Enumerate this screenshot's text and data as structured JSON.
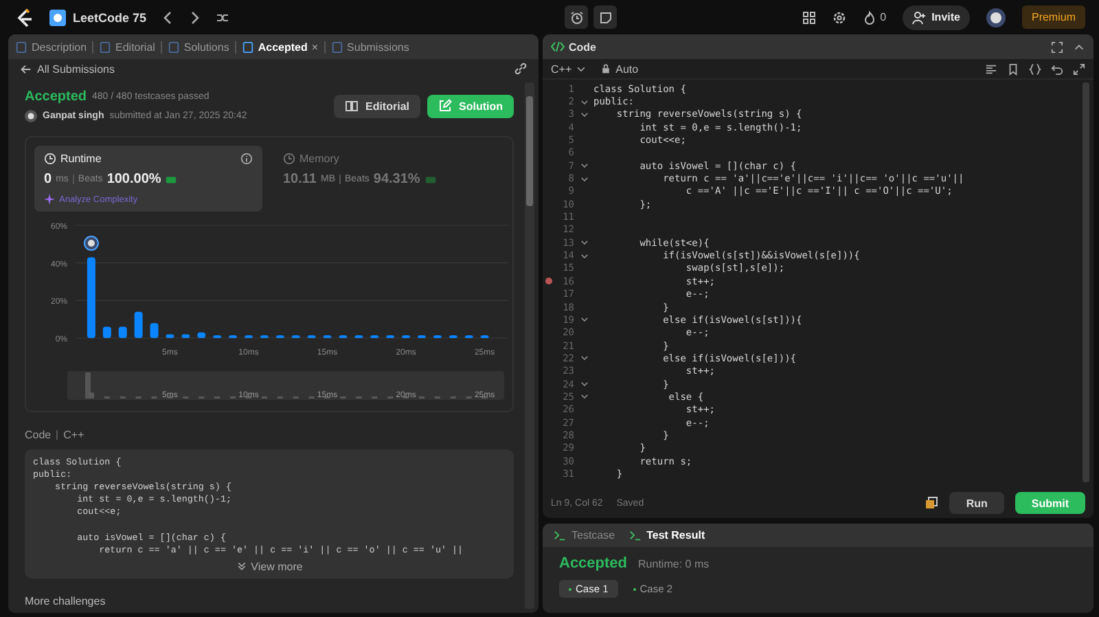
{
  "topbar": {
    "title": "LeetCode 75",
    "streak": "0",
    "invite": "Invite",
    "premium": "Premium"
  },
  "tabs": [
    {
      "label": "Description",
      "selected": false
    },
    {
      "label": "Editorial",
      "selected": false
    },
    {
      "label": "Solutions",
      "selected": false
    },
    {
      "label": "Accepted",
      "selected": true,
      "close": "×"
    },
    {
      "label": "Submissions",
      "selected": false
    }
  ],
  "back": "All Submissions",
  "result": {
    "status": "Accepted",
    "passed": "480 / 480 testcases passed",
    "user": "Ganpat singh",
    "submitted": "submitted at Jan 27, 2025 20:42",
    "editorial": "Editorial",
    "solution": "Solution"
  },
  "stats": [
    {
      "title": "Runtime",
      "value": "0",
      "unit": "ms",
      "beats_label": "Beats",
      "beats": "100.00%",
      "selected": true,
      "link": "Analyze Complexity"
    },
    {
      "title": "Memory",
      "value": "10.11",
      "unit": "MB",
      "beats_label": "Beats",
      "beats": "94.31%",
      "selected": false
    }
  ],
  "chart_data": {
    "type": "bar",
    "x": [
      0,
      1,
      2,
      3,
      4,
      5,
      6,
      7,
      8,
      9,
      10,
      11,
      12,
      13,
      14,
      15,
      16,
      17,
      18,
      19,
      20,
      21,
      22,
      23,
      24,
      25
    ],
    "series": [
      {
        "color": "#0a84ff",
        "values": [
          43,
          6,
          6,
          14,
          8,
          2,
          2,
          3,
          1.5,
          1.5,
          1.5,
          1.5,
          1.5,
          1.5,
          1.5,
          1.5,
          1.5,
          1.5,
          1.5,
          1.5,
          1.5,
          1.5,
          1.5,
          1.5,
          1.5,
          1.5
        ]
      }
    ],
    "xlim": [
      -1,
      26.5
    ],
    "ylim": [
      0,
      60
    ],
    "yticks": [
      {
        "value": 0,
        "label": "0%"
      },
      {
        "value": 20,
        "label": "20%"
      },
      {
        "value": 40,
        "label": "40%"
      },
      {
        "value": 60,
        "label": "60%"
      }
    ],
    "xticks": [
      {
        "value": 5,
        "label": "5ms"
      },
      {
        "value": 10,
        "label": "10ms"
      },
      {
        "value": 15,
        "label": "15ms"
      },
      {
        "value": 20,
        "label": "20ms"
      },
      {
        "value": 25,
        "label": "25ms"
      }
    ]
  },
  "code_header": {
    "label": "Code",
    "language": "C++"
  },
  "code_preview": "class Solution {\npublic:\n    string reverseVowels(string s) {\n        int st = 0,e = s.length()-1;\n        cout<<e;\n\n        auto isVowel = [](char c) {\n            return c == 'a' || c == 'e' || c == 'i' || c == 'o' || c == 'u' ||",
  "view_more": "View more",
  "more": "More challenges",
  "editor": {
    "title": "Code",
    "language": "C++",
    "mode": "Auto",
    "lines": [
      {
        "n": "1",
        "code": "class Solution {",
        "fold": false,
        "breakpoint": false
      },
      {
        "n": "2",
        "code": "public:",
        "fold": true,
        "breakpoint": false
      },
      {
        "n": "3",
        "code": "    string reverseVowels(string s) {",
        "fold": true,
        "breakpoint": false
      },
      {
        "n": "4",
        "code": "        int st = 0,e = s.length()-1;",
        "fold": false,
        "breakpoint": false
      },
      {
        "n": "5",
        "code": "        cout<<e;",
        "fold": false,
        "breakpoint": false
      },
      {
        "n": "6",
        "fold": false,
        "breakpoint": false
      },
      {
        "n": "7",
        "code": "        auto isVowel = [](char c) {",
        "fold": true,
        "breakpoint": false
      },
      {
        "n": "8",
        "code": "            return c == 'a'||c=='e'||c== 'i'||c== 'o'||c =='u'||",
        "fold": true,
        "breakpoint": false
      },
      {
        "n": "9",
        "code": "                c =='A' ||c =='E'||c =='I'|| c =='O'||c =='U';",
        "fold": false,
        "breakpoint": false
      },
      {
        "n": "10",
        "code": "        };",
        "fold": false,
        "breakpoint": false
      },
      {
        "n": "11",
        "fold": false,
        "breakpoint": false
      },
      {
        "n": "12",
        "fold": false,
        "breakpoint": false
      },
      {
        "n": "13",
        "code": "        while(st<e){",
        "fold": true,
        "breakpoint": false
      },
      {
        "n": "14",
        "code": "            if(isVowel(s[st])&&isVowel(s[e])){",
        "fold": true,
        "breakpoint": false
      },
      {
        "n": "15",
        "code": "                swap(s[st],s[e]);",
        "fold": false,
        "breakpoint": false
      },
      {
        "n": "16",
        "code": "                st++;",
        "fold": false,
        "breakpoint": true
      },
      {
        "n": "17",
        "code": "                e--;",
        "fold": false,
        "breakpoint": false
      },
      {
        "n": "18",
        "code": "            }",
        "fold": false,
        "breakpoint": false
      },
      {
        "n": "19",
        "code": "            else if(isVowel(s[st])){",
        "fold": true,
        "breakpoint": false
      },
      {
        "n": "20",
        "code": "                e--;",
        "fold": false,
        "breakpoint": false
      },
      {
        "n": "21",
        "code": "            }",
        "fold": false,
        "breakpoint": false
      },
      {
        "n": "22",
        "code": "            else if(isVowel(s[e])){",
        "fold": true,
        "breakpoint": false
      },
      {
        "n": "23",
        "code": "                st++;",
        "fold": false,
        "breakpoint": false
      },
      {
        "n": "24",
        "code": "            }",
        "fold": true,
        "breakpoint": false
      },
      {
        "n": "25",
        "code": "             else {",
        "fold": true,
        "breakpoint": false
      },
      {
        "n": "26",
        "code": "                st++;",
        "fold": false,
        "breakpoint": false
      },
      {
        "n": "27",
        "code": "                e--;",
        "fold": false,
        "breakpoint": false
      },
      {
        "n": "28",
        "code": "            }",
        "fold": false,
        "breakpoint": false
      },
      {
        "n": "29",
        "code": "        }",
        "fold": false,
        "breakpoint": false
      },
      {
        "n": "30",
        "code": "        return s;",
        "fold": false,
        "breakpoint": false
      },
      {
        "n": "31",
        "code": "    }",
        "fold": false,
        "breakpoint": false
      }
    ],
    "position": "Ln 9, Col 62",
    "saved": "Saved",
    "run": "Run",
    "submit": "Submit"
  },
  "console": {
    "tabs": [
      {
        "label": "Testcase",
        "selected": false
      },
      {
        "label": "Test Result",
        "selected": true
      }
    ],
    "status": "Accepted",
    "runtime": "Runtime: 0 ms",
    "cases": [
      {
        "label": "Case 1",
        "selected": true
      },
      {
        "label": "Case 2",
        "selected": false
      }
    ]
  }
}
